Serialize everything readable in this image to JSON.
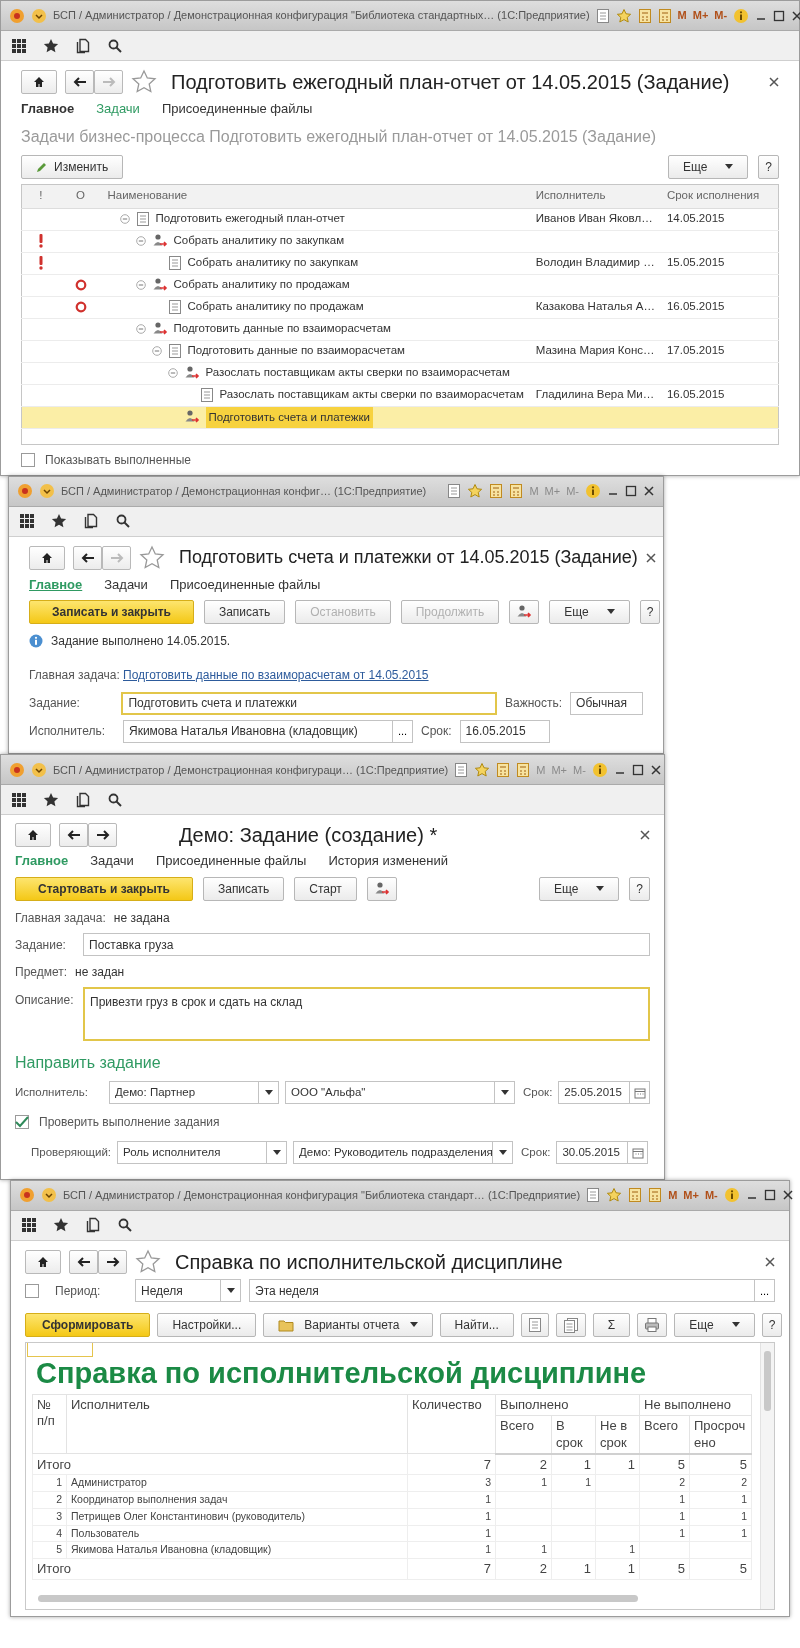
{
  "windows": [
    {
      "kind": "task_tree",
      "caption": "БСП / Администратор / Демонстрационная конфигурация \"Библиотека стандартных… (1С:Предприятие)",
      "memory_buttons": [
        "M",
        "M+",
        "M-"
      ],
      "memory_enabled": true,
      "star": true,
      "forward_enabled": false,
      "title": "Подготовить ежегодный план-отчет от 14.05.2015 (Задание)",
      "tabs": [
        {
          "label": "Главное",
          "selected": false,
          "bold": true
        },
        {
          "label": "Задачи",
          "selected": true,
          "bold": false
        },
        {
          "label": "Присоединенные файлы",
          "selected": false,
          "bold": false
        }
      ],
      "subtitle": "Задачи бизнес-процесса Подготовить ежегодный план-отчет от 14.05.2015 (Задание)",
      "edit_button": "Изменить",
      "more_button": "Еще",
      "help_button": "?",
      "columns": [
        "!",
        "O",
        "Наименование",
        "Исполнитель",
        "Срок исполнения"
      ],
      "rows": [
        {
          "kind": "document",
          "name": "Подготовить ежегодный план-отчет",
          "executor": "Иванов Иван Яковл…",
          "due": "14.05.2015",
          "high_importance": false,
          "low_importance": false,
          "selected": false,
          "expanded": true,
          "children": [
            {
              "kind": "process",
              "name": "Собрать аналитику по закупкам",
              "high_importance": true,
              "low_importance": false,
              "selected": false,
              "expanded": true,
              "children": [
                {
                  "kind": "document",
                  "name": "Собрать аналитику по закупкам",
                  "executor": "Володин Владимир …",
                  "due": "15.05.2015",
                  "high_importance": true,
                  "low_importance": false,
                  "selected": false
                }
              ]
            },
            {
              "kind": "process",
              "name": "Собрать аналитику по продажам",
              "high_importance": false,
              "low_importance": true,
              "selected": false,
              "expanded": true,
              "children": [
                {
                  "kind": "document",
                  "name": "Собрать аналитику по продажам",
                  "executor": "Казакова Наталья А…",
                  "due": "16.05.2015",
                  "high_importance": false,
                  "low_importance": true,
                  "selected": false
                }
              ]
            },
            {
              "kind": "process",
              "name": "Подготовить данные по взаиморасчетам",
              "high_importance": false,
              "low_importance": false,
              "selected": false,
              "expanded": true,
              "children": [
                {
                  "kind": "document",
                  "name": "Подготовить данные по взаиморасчетам",
                  "executor": "Мазина Мария Конс…",
                  "due": "17.05.2015",
                  "high_importance": false,
                  "low_importance": false,
                  "selected": false,
                  "expanded": true,
                  "children": [
                    {
                      "kind": "process",
                      "name": "Разослать поставщикам акты сверки по взаиморасчетам",
                      "high_importance": false,
                      "low_importance": false,
                      "selected": false,
                      "expanded": true,
                      "children": [
                        {
                          "kind": "document",
                          "name": "Разослать поставщикам акты сверки по взаиморасчетам",
                          "executor": "Гладилина Вера Ми…",
                          "due": "16.05.2015",
                          "high_importance": false,
                          "low_importance": false,
                          "selected": false
                        }
                      ]
                    },
                    {
                      "kind": "process",
                      "name": "Подготовить счета и платежки",
                      "high_importance": false,
                      "low_importance": false,
                      "selected": true
                    }
                  ]
                }
              ]
            }
          ]
        }
      ],
      "show_completed": {
        "label": "Показывать выполненные",
        "checked": false
      }
    },
    {
      "kind": "task_form",
      "caption": "БСП / Администратор / Демонстрационная конфиг… (1С:Предприятие)",
      "memory_buttons": [
        "M",
        "M+",
        "M-"
      ],
      "memory_enabled": false,
      "star": true,
      "forward_enabled": false,
      "title": "Подготовить счета и платежки от 14.05.2015 (Задание)",
      "tabs": [
        {
          "label": "Главное",
          "selected": true
        },
        {
          "label": "Задачи",
          "selected": false
        },
        {
          "label": "Присоединенные файлы",
          "selected": false
        }
      ],
      "buttons": [
        {
          "kind": "primary",
          "label": "Записать и закрыть",
          "disabled": false
        },
        {
          "kind": "normal",
          "label": "Записать",
          "disabled": false
        },
        {
          "kind": "normal",
          "label": "Остановить",
          "disabled": true
        },
        {
          "kind": "normal",
          "label": "Продолжить",
          "disabled": true
        },
        {
          "kind": "route",
          "disabled": false
        }
      ],
      "more_button": "Еще",
      "help_button": "?",
      "notice": "Задание выполнено 14.05.2015.",
      "main_task": {
        "label": "Главная задача:",
        "value": "Подготовить данные по взаиморасчетам от 14.05.2015"
      },
      "task": {
        "label": "Задание:",
        "value": "Подготовить счета и платежки",
        "focused": true
      },
      "importance": {
        "label": "Важность:",
        "value": "Обычная"
      },
      "executor": {
        "label": "Исполнитель:",
        "value": "Якимова Наталья Ивановна (кладовщик)",
        "button": "..."
      },
      "due": {
        "label": "Срок:",
        "value": "16.05.2015"
      }
    },
    {
      "kind": "new_task_form",
      "caption": "БСП / Администратор / Демонстрационная конфигураци… (1С:Предприятие)",
      "memory_buttons": [
        "M",
        "M+",
        "M-"
      ],
      "memory_enabled": false,
      "star": false,
      "forward_enabled": true,
      "title": "Демо: Задание (создание) *",
      "tabs": [
        {
          "label": "Главное",
          "selected": true
        },
        {
          "label": "Задачи",
          "selected": false
        },
        {
          "label": "Присоединенные файлы",
          "selected": false
        },
        {
          "label": "История изменений",
          "selected": false
        }
      ],
      "buttons": [
        {
          "kind": "primary",
          "label": "Стартовать и закрыть"
        },
        {
          "kind": "normal",
          "label": "Записать"
        },
        {
          "kind": "normal",
          "label": "Старт"
        },
        {
          "kind": "route"
        }
      ],
      "more_button": "Еще",
      "help_button": "?",
      "main_task": {
        "label": "Главная задача:",
        "value": "не задана"
      },
      "task": {
        "label": "Задание:",
        "value": "Поставка груза",
        "focused": false
      },
      "subject": {
        "label": "Предмет:",
        "value": "не задан"
      },
      "description": {
        "label": "Описание:",
        "value": "Привезти груз в срок и сдать на склад",
        "focused": true
      },
      "section": "Направить задание",
      "executor": {
        "label": "Исполнитель:",
        "type": "Демо: Партнер",
        "value": "ООО \"Альфа\"",
        "due_label": "Срок:",
        "due": "25.05.2015"
      },
      "check": {
        "label": "Проверить выполнение задания",
        "checked": true
      },
      "reviewer": {
        "label": "Проверяющий:",
        "type": "Роль исполнителя",
        "value": "Демо: Руководитель подразделения",
        "due_label": "Срок:",
        "due": "30.05.2015"
      }
    },
    {
      "kind": "report",
      "caption": "БСП / Администратор / Демонстрационная конфигурация \"Библиотека стандарт… (1С:Предприятие)",
      "memory_buttons": [
        "M",
        "M+",
        "M-"
      ],
      "memory_enabled": true,
      "star": true,
      "forward_enabled": true,
      "title": "Справка по исполнительской дисциплине",
      "period": {
        "checked": false,
        "label": "Период:",
        "type": "Неделя",
        "value": "Эта неделя",
        "button": "..."
      },
      "buttons": [
        {
          "kind": "primary",
          "label": "Сформировать"
        },
        {
          "kind": "normal",
          "label": "Настройки..."
        },
        {
          "kind": "menu",
          "label": "Варианты отчета"
        },
        {
          "kind": "normal",
          "label": "Найти..."
        },
        {
          "kind": "document"
        },
        {
          "kind": "documents"
        },
        {
          "kind": "normal",
          "label": "Σ"
        },
        {
          "kind": "printer"
        }
      ],
      "more_button": "Еще",
      "help_button": "?",
      "report": {
        "heading": "Справка по исполнительской дисциплине",
        "columns": {
          "number": "№ п/п",
          "executor": "Исполнитель",
          "count": "Количество",
          "groups": [
            {
              "label": "Выполнено",
              "sub": [
                "Всего",
                "В срок",
                "Не в срок"
              ]
            },
            {
              "label": "Не выполнено",
              "sub": [
                "Всего",
                "Просрочено"
              ]
            }
          ]
        },
        "rows": [
          {
            "kind": "total",
            "label": "Итого",
            "count": "7",
            "done_total": "2",
            "done_on_time": "1",
            "done_late": "1",
            "undone_total": "5",
            "overdue": "5"
          },
          {
            "kind": "item",
            "num": "1",
            "label": "Администратор",
            "count": "3",
            "done_total": "1",
            "done_on_time": "1",
            "undone_total": "2",
            "overdue": "2"
          },
          {
            "kind": "item",
            "num": "2",
            "label": "Координатор выполнения задач",
            "count": "1",
            "undone_total": "1",
            "overdue": "1"
          },
          {
            "kind": "item",
            "num": "3",
            "label": "Петрищев Олег Константинович (руководитель)",
            "count": "1",
            "undone_total": "1",
            "overdue": "1"
          },
          {
            "kind": "item",
            "num": "4",
            "label": "Пользователь",
            "count": "1",
            "undone_total": "1",
            "overdue": "1"
          },
          {
            "kind": "item",
            "num": "5",
            "label": "Якимова Наталья Ивановна (кладовщик)",
            "count": "1",
            "done_total": "1",
            "done_late": "1"
          },
          {
            "kind": "total",
            "label": "Итого",
            "count": "7",
            "done_total": "2",
            "done_on_time": "1",
            "done_late": "1",
            "undone_total": "5",
            "overdue": "5"
          }
        ]
      }
    }
  ]
}
